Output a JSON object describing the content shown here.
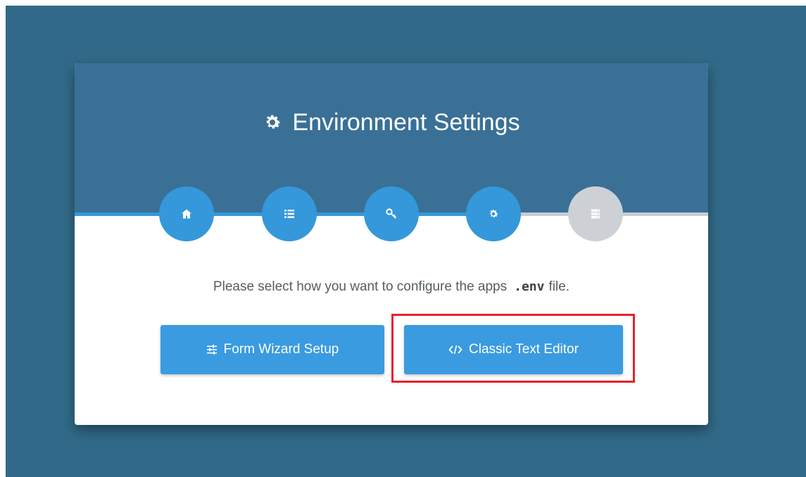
{
  "header": {
    "title": "Environment Settings",
    "title_icon": "gear-icon"
  },
  "steps": [
    {
      "icon": "home-icon",
      "completed": true
    },
    {
      "icon": "list-icon",
      "completed": true
    },
    {
      "icon": "key-icon",
      "completed": true
    },
    {
      "icon": "gear-icon",
      "completed": true
    },
    {
      "icon": "server-icon",
      "completed": false
    }
  ],
  "progress": {
    "fraction_complete": 0.8
  },
  "content": {
    "prompt_before": "Please select how you want to configure the apps",
    "prompt_code": ".env",
    "prompt_after": "file."
  },
  "buttons": {
    "form_wizard_label": "Form Wizard Setup",
    "form_wizard_icon": "sliders-icon",
    "classic_editor_label": "Classic Text Editor",
    "classic_editor_icon": "code-icon"
  },
  "colors": {
    "page_background": "#316a88",
    "header_background": "#3a7096",
    "accent": "#3498db",
    "inactive_step": "#cdd1d5",
    "highlight": "#e8202a"
  }
}
